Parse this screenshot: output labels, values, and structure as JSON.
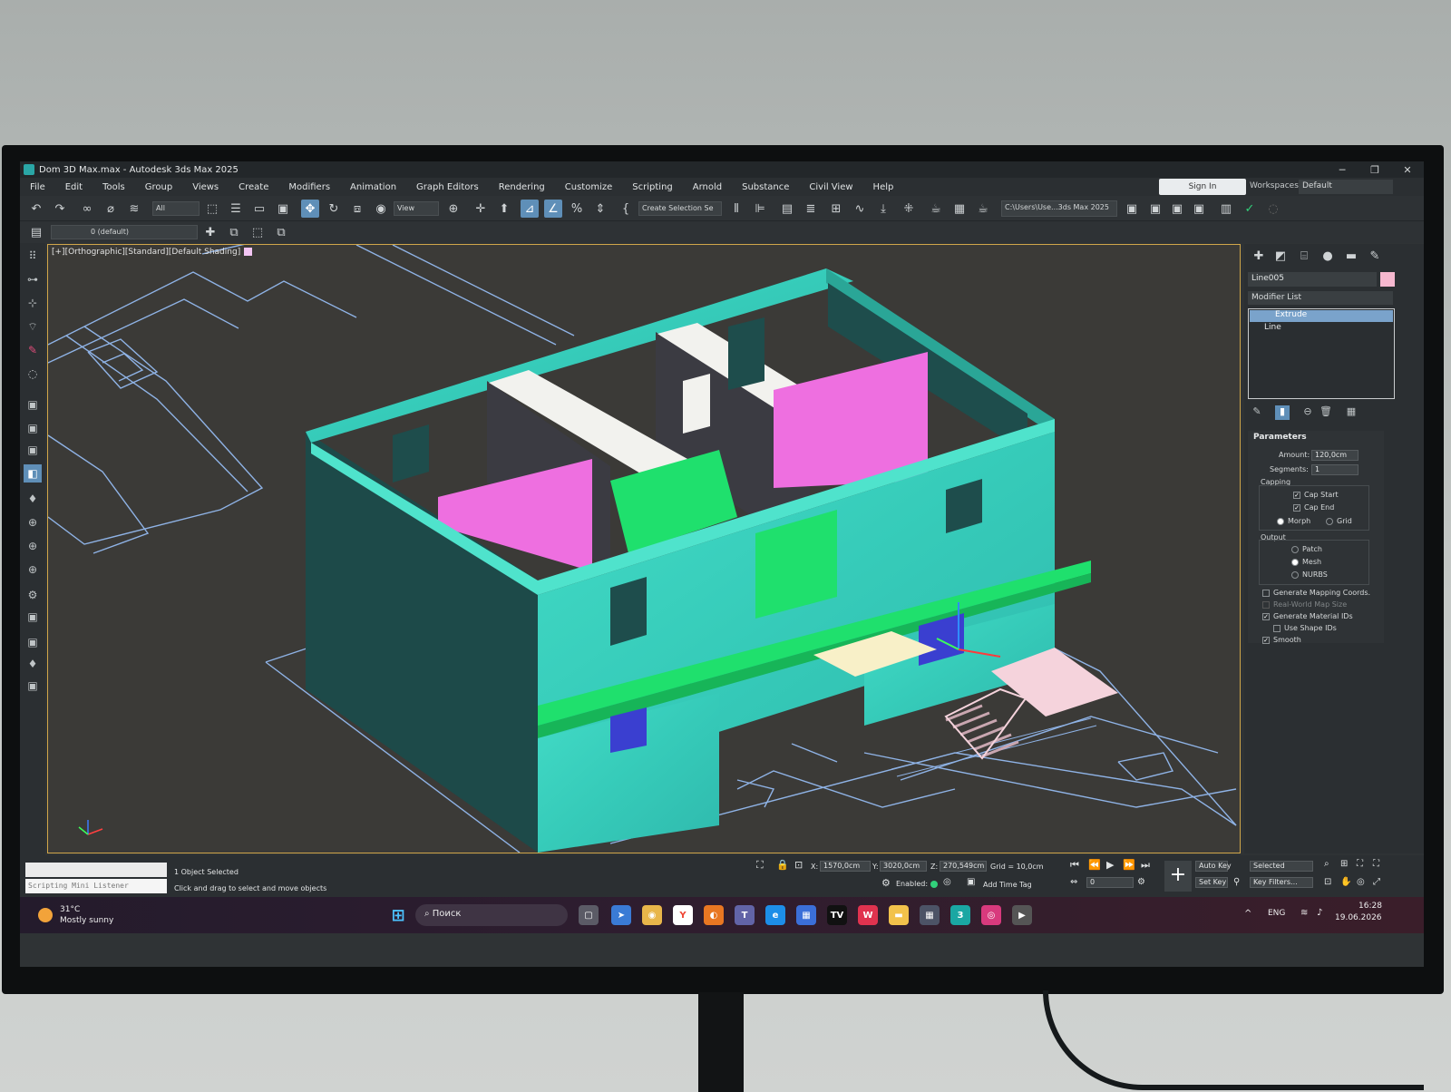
{
  "window": {
    "title": "Dom 3D Max.max - Autodesk 3ds Max 2025",
    "controls": [
      "─",
      "❐",
      "✕"
    ]
  },
  "menu": [
    "File",
    "Edit",
    "Tools",
    "Group",
    "Views",
    "Create",
    "Modifiers",
    "Animation",
    "Graph Editors",
    "Rendering",
    "Customize",
    "Scripting",
    "Arnold",
    "Substance",
    "Civil View",
    "Help"
  ],
  "account": {
    "sign_in": "Sign In",
    "workspaces_label": "Workspaces:",
    "workspace_value": "Default"
  },
  "toolbar": {
    "selection_filter": "All",
    "ref_coord": "View",
    "named_selection": "Create Selection Se",
    "project_path": "C:\\Users\\Use...3ds Max 2025",
    "layer": "0 (default)"
  },
  "viewport": {
    "label": "[+][Orthographic][Standard][Default Shading]",
    "colors": {
      "walls": "#39d6c0",
      "walls_dark": "#1d4a49",
      "pink": "#ee6fe0",
      "green": "#1fe06d",
      "stairs": "#f5d3dc",
      "lines": "#8fb3e6"
    }
  },
  "command_panel": {
    "object_name": "Line005",
    "object_color": "#f6b8cf",
    "modifier_list": "Modifier List",
    "stack": [
      "Extrude",
      "Line"
    ],
    "parameters": {
      "title": "Parameters",
      "amount_label": "Amount:",
      "amount": "120,0cm",
      "segments_label": "Segments:",
      "segments": "1",
      "capping_label": "Capping",
      "cap_start": "Cap Start",
      "cap_end": "Cap End",
      "morph": "Morph",
      "grid": "Grid",
      "output_label": "Output",
      "patch": "Patch",
      "mesh": "Mesh",
      "nurbs": "NURBS",
      "gen_mapping": "Generate Mapping Coords.",
      "real_world": "Real-World Map Size",
      "gen_mat_ids": "Generate Material IDs",
      "use_shape_ids": "Use Shape IDs",
      "smooth": "Smooth"
    }
  },
  "status": {
    "listener": "Scripting Mini Listener",
    "selection": "1 Object Selected",
    "prompt": "Click and drag to select and move objects",
    "x_label": "X:",
    "x": "1570,0cm",
    "y_label": "Y:",
    "y": "3020,0cm",
    "z_label": "Z:",
    "z": "270,549cm",
    "grid": "Grid = 10,0cm",
    "enabled_label": "Enabled:",
    "add_time_tag": "Add Time Tag",
    "frame": "0",
    "auto_key": "Auto Key",
    "set_key": "Set Key",
    "key_mode": "Selected",
    "key_filters": "Key Filters..."
  },
  "taskbar": {
    "weather_temp": "31°C",
    "weather_text": "Mostly sunny",
    "search": "Поиск",
    "language": "ENG",
    "time": "16:28",
    "date": "19.06.2026"
  }
}
